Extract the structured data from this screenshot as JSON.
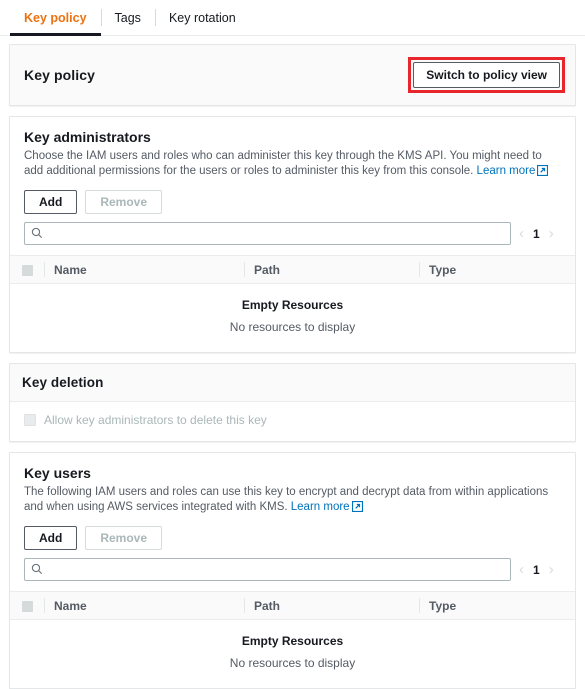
{
  "tabs": [
    {
      "label": "Key policy",
      "active": true
    },
    {
      "label": "Tags",
      "active": false
    },
    {
      "label": "Key rotation",
      "active": false
    }
  ],
  "policy_card": {
    "title": "Key policy",
    "switch_button": "Switch to policy view",
    "highlight_color": "#e8262b"
  },
  "key_administrators": {
    "title": "Key administrators",
    "description": "Choose the IAM users and roles who can administer this key through the KMS API. You might need to add additional permissions for the users or roles to administer this key from this console. ",
    "learn_more": "Learn more",
    "add_label": "Add",
    "remove_label": "Remove",
    "search_placeholder": "",
    "search_value": "",
    "search_icon": "search-icon",
    "page_number": "1",
    "prev_icon": "chevron-left-icon",
    "next_icon": "chevron-right-icon",
    "columns": [
      "Name",
      "Path",
      "Type"
    ],
    "empty_title": "Empty Resources",
    "empty_subtitle": "No resources to display"
  },
  "key_deletion": {
    "title": "Key deletion",
    "checkbox_label": "Allow key administrators to delete this key",
    "checked": false,
    "disabled": true
  },
  "key_users": {
    "title": "Key users",
    "description": "The following IAM users and roles can use this key to encrypt and decrypt data from within applications and when using AWS services integrated with KMS. ",
    "learn_more": "Learn more",
    "add_label": "Add",
    "remove_label": "Remove",
    "search_placeholder": "",
    "search_value": "",
    "search_icon": "search-icon",
    "page_number": "1",
    "prev_icon": "chevron-left-icon",
    "next_icon": "chevron-right-icon",
    "columns": [
      "Name",
      "Path",
      "Type"
    ],
    "empty_title": "Empty Resources",
    "empty_subtitle": "No resources to display"
  },
  "colors": {
    "accent_orange": "#ec7211",
    "link_blue": "#0073bb",
    "text_primary": "#16191f",
    "text_secondary": "#545b64",
    "disabled": "#aab7b8"
  }
}
